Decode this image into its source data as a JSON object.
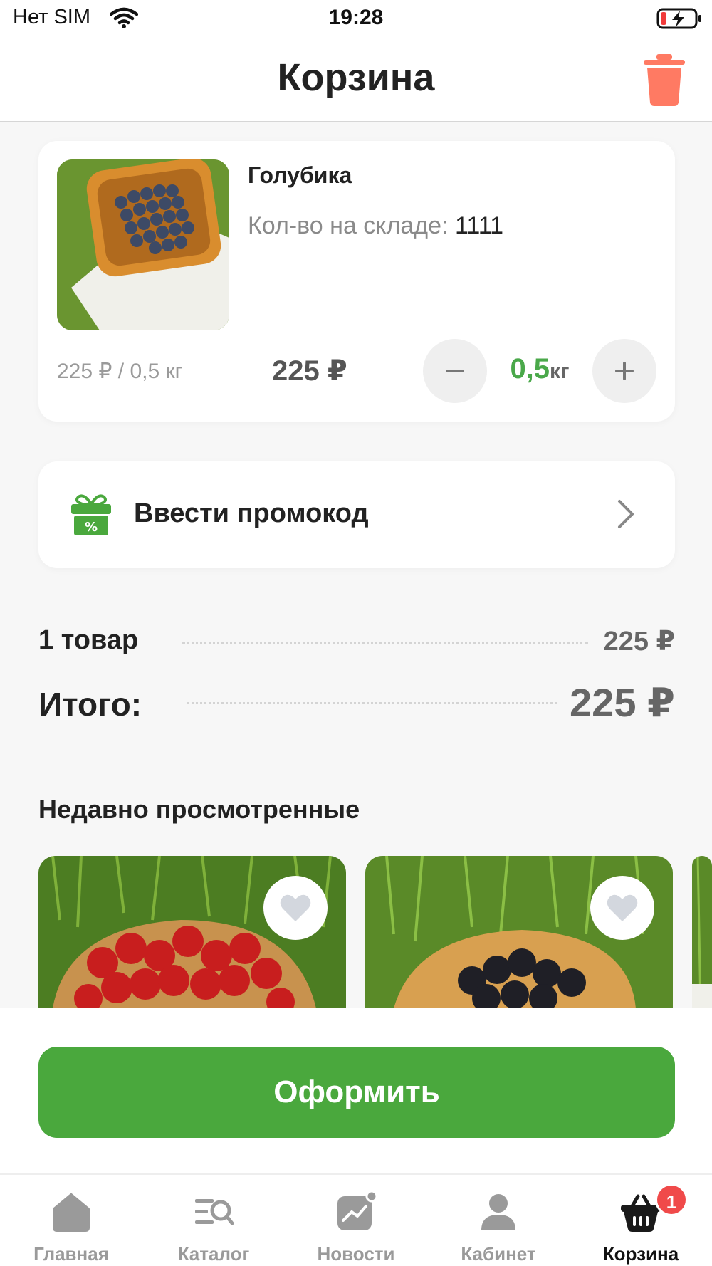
{
  "status_bar": {
    "carrier": "Нет SIM",
    "time": "19:28"
  },
  "header": {
    "title": "Корзина"
  },
  "cart_item": {
    "name": "Голубика",
    "stock_label": "Кол-во на складе: ",
    "stock_value": "1111",
    "unit_price": "225 ₽ / 0,5 кг",
    "total": "225 ₽",
    "quantity_value": "0,5",
    "quantity_unit": "кг"
  },
  "promo": {
    "label": "Ввести промокод"
  },
  "summary": {
    "items_label": "1 товар",
    "items_value": "225 ₽",
    "total_label": "Итого:",
    "total_value": "225 ₽"
  },
  "recent": {
    "title": "Недавно просмотренные"
  },
  "checkout": {
    "label": "Оформить"
  },
  "tabs": [
    {
      "label": "Главная",
      "icon": "home-icon"
    },
    {
      "label": "Каталог",
      "icon": "catalog-search-icon"
    },
    {
      "label": "Новости",
      "icon": "news-chart-icon"
    },
    {
      "label": "Кабинет",
      "icon": "user-icon"
    },
    {
      "label": "Корзина",
      "icon": "basket-icon",
      "badge": "1",
      "active": true
    }
  ],
  "colors": {
    "accent_green": "#4aa83d",
    "trash_red": "#ff7a63",
    "badge_red": "#f04a4a",
    "quantity_green": "#4aa84a"
  }
}
